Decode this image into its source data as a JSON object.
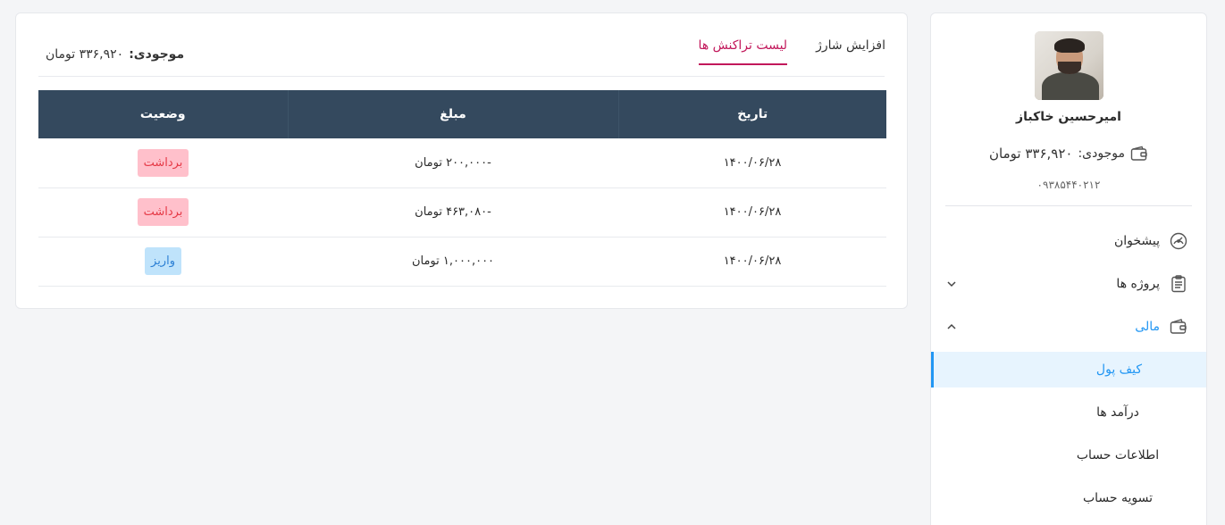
{
  "sidebar": {
    "user_name": "امیرحسین خاکباز",
    "balance_label": "موجودی:",
    "balance_amount": "۳۳۶,۹۲۰ تومان",
    "phone": "۰۹۳۸۵۴۴۰۲۱۲",
    "menu": [
      {
        "label": "پیشخوان",
        "icon": "dashboard-icon"
      },
      {
        "label": "پروژه ها",
        "icon": "clipboard-icon"
      },
      {
        "label": "مالی",
        "icon": "wallet-icon"
      }
    ],
    "submenu": [
      {
        "label": "کیف پول"
      },
      {
        "label": "درآمد ها"
      },
      {
        "label": "اطلاعات حساب"
      },
      {
        "label": "تسویه حساب"
      }
    ]
  },
  "main": {
    "tabs": [
      {
        "label": "افزایش شارژ"
      },
      {
        "label": "لیست تراکنش ها"
      }
    ],
    "balance_label": "موجودی:",
    "balance_amount": "۳۳۶,۹۲۰ تومان",
    "table": {
      "headers": {
        "date": "تاریخ",
        "amount": "مبلغ",
        "status": "وضعیت"
      },
      "rows": [
        {
          "date": "۱۴۰۰/۰۶/۲۸",
          "amount": "-۲۰۰,۰۰۰ تومان",
          "status": "برداشت"
        },
        {
          "date": "۱۴۰۰/۰۶/۲۸",
          "amount": "-۴۶۳,۰۸۰ تومان",
          "status": "برداشت"
        },
        {
          "date": "۱۴۰۰/۰۶/۲۸",
          "amount": "۱,۰۰۰,۰۰۰ تومان",
          "status": "واریز"
        }
      ]
    }
  },
  "colors": {
    "accent": "#2196f3",
    "tab_active": "#c2185b",
    "table_header": "#34495e",
    "withdraw_bg": "#ffc0cb",
    "withdraw_text": "#e53946",
    "deposit_bg": "#bfe3fb",
    "deposit_text": "#2b7fd4"
  }
}
